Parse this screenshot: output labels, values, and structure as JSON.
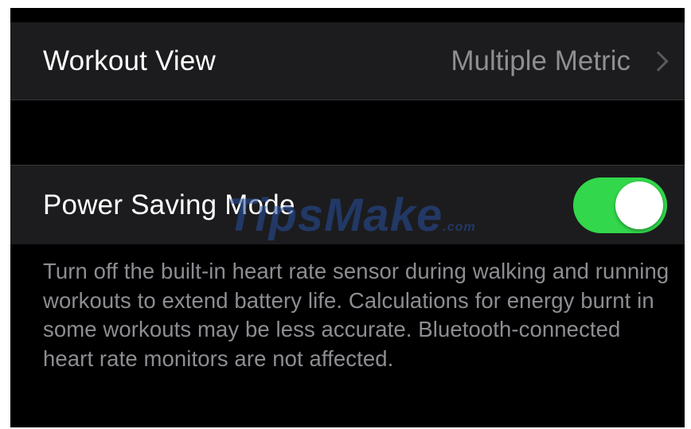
{
  "workout_view": {
    "label": "Workout View",
    "value": "Multiple Metric"
  },
  "power_saving": {
    "label": "Power Saving Mode",
    "enabled": true,
    "toggle_color": "#32d74b",
    "description": "Turn off the built-in heart rate sensor during walking and running workouts to extend battery life. Calculations for energy burnt in some workouts may be less accurate. Bluetooth-connected heart rate monitors are not affected."
  },
  "watermark": {
    "text": "TipsMake",
    "suffix": ".com"
  },
  "icons": {
    "chevron": "chevron-right-icon"
  }
}
